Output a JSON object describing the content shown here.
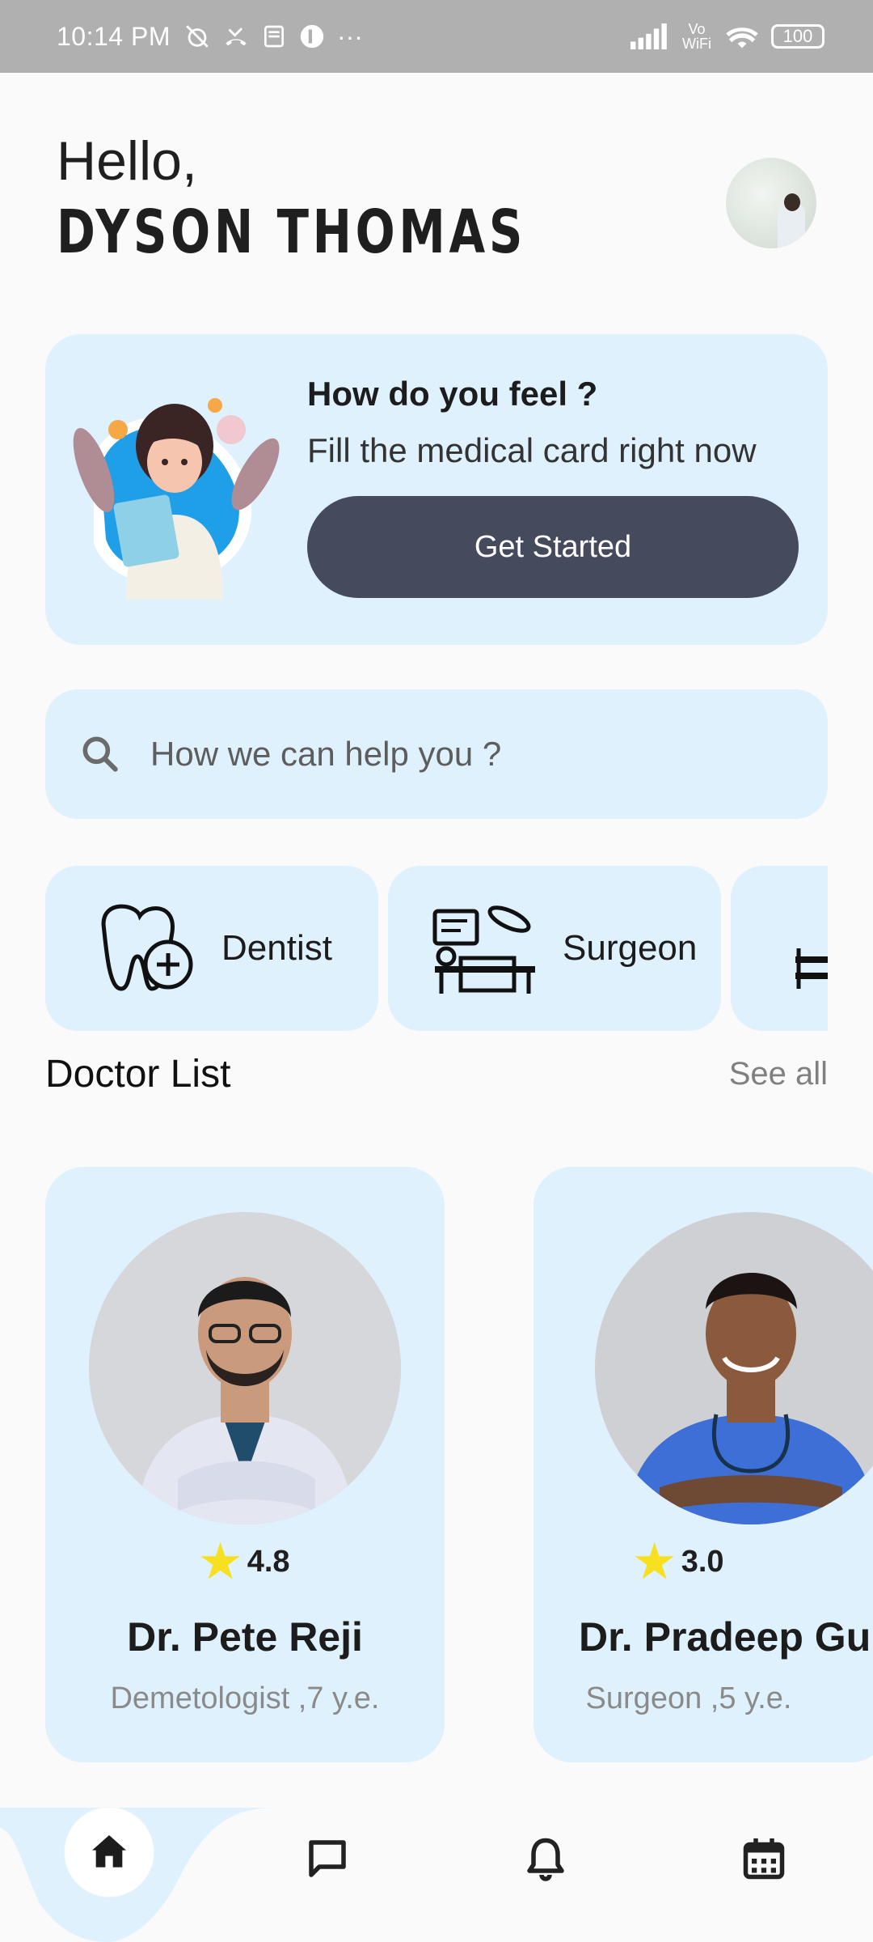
{
  "status_bar": {
    "time": "10:14 PM",
    "dots": "···",
    "wifi_label": "Vo WiFi",
    "battery": "100"
  },
  "header": {
    "greeting": "Hello,",
    "user_name": "DYSON THOMAS"
  },
  "promo": {
    "title": "How do you feel ?",
    "subtitle": "Fill the medical card right now",
    "button_label": "Get Started"
  },
  "search": {
    "placeholder": "How we can help you ?"
  },
  "categories": [
    {
      "label": "Dentist",
      "icon": "tooth-plus-icon"
    },
    {
      "label": "Surgeon",
      "icon": "surgery-icon"
    },
    {
      "label": "",
      "icon": "hospital-bed-icon"
    }
  ],
  "doctor_section": {
    "title": "Doctor List",
    "see_all": "See all"
  },
  "doctors": [
    {
      "rating": "4.8",
      "name": "Dr. Pete Reji",
      "specialty": "Demetologist ,7 y.e."
    },
    {
      "rating": "3.0",
      "name": "Dr. Pradeep Gup",
      "specialty": "Surgeon ,5 y.e."
    }
  ],
  "bottom_nav": [
    "home-icon",
    "chat-icon",
    "bell-icon",
    "calendar-icon"
  ],
  "colors": {
    "card_bg": "#dff1fd",
    "button_bg": "#454a5d",
    "star": "#f6e01f"
  }
}
